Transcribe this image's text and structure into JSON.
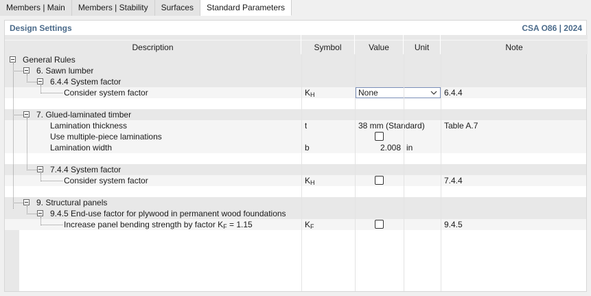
{
  "tabs": [
    "Members | Main",
    "Members | Stability",
    "Surfaces",
    "Standard Parameters"
  ],
  "panel": {
    "title": "Design Settings",
    "standard": "CSA O86 | 2024"
  },
  "columns": {
    "description": "Description",
    "symbol": "Symbol",
    "value": "Value",
    "unit": "Unit",
    "note": "Note"
  },
  "tree": {
    "general_rules": "General Rules",
    "sawn_lumber": "6. Sawn lumber",
    "sawn_system_factor": "6.4.4 System factor",
    "sawn_consider_system_factor": {
      "label": "Consider system factor",
      "symbol_main": "K",
      "symbol_sub": "H",
      "value": "None",
      "note": "6.4.4"
    },
    "glulam": "7. Glued-laminated timber",
    "lamination_thickness": {
      "label": "Lamination thickness",
      "symbol": "t",
      "value": "38 mm (Standard)",
      "note": "Table A.7"
    },
    "multiple_piece": {
      "label": "Use multiple-piece laminations",
      "checked": false
    },
    "lamination_width": {
      "label": "Lamination width",
      "symbol": "b",
      "value": "2.008",
      "unit": "in"
    },
    "glulam_system_factor": "7.4.4 System factor",
    "glulam_consider_system_factor": {
      "label": "Consider system factor",
      "symbol_main": "K",
      "symbol_sub": "H",
      "checked": false,
      "note": "7.4.4"
    },
    "structural_panels": "9. Structural panels",
    "end_use_factor": "9.4.5 End-use factor for plywood in permanent wood foundations",
    "increase_panel": {
      "label_prefix": "Increase panel bending strength by factor K",
      "label_sub": "F",
      "label_suffix": " = 1.15",
      "symbol_main": "K",
      "symbol_sub": "F",
      "checked": false,
      "note": "9.4.5"
    }
  }
}
